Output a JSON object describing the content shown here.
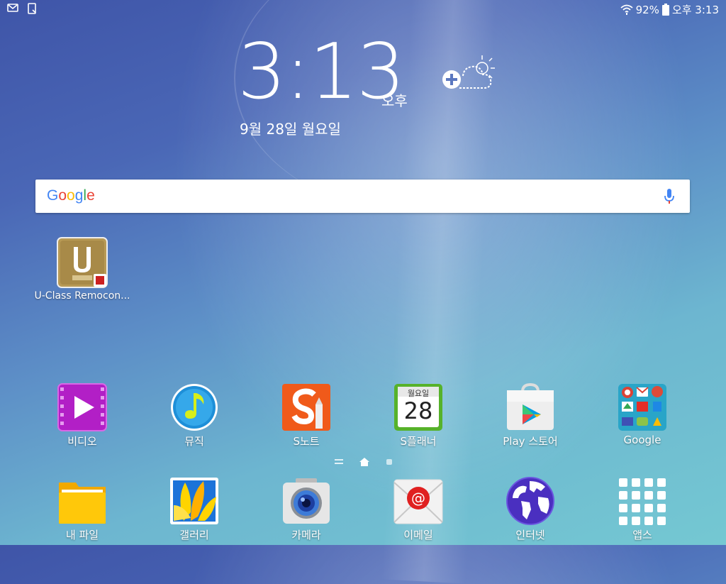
{
  "status_bar": {
    "battery_percent": "92%",
    "time": "오후 3:13",
    "icons": [
      "email-notification-icon",
      "screenshot-notification-icon",
      "wifi-icon",
      "battery-icon"
    ]
  },
  "clock": {
    "time": "3:13",
    "ampm": "오후",
    "date": "9월 28일 월요일"
  },
  "weather_widget": {
    "icon": "add-weather-icon"
  },
  "search_bar": {
    "logo": "Google",
    "icon": "mic-icon"
  },
  "desktop_shortcut": {
    "label": "U-Class Remocon...",
    "icon": "uclass-remocon-icon"
  },
  "apps_row": [
    {
      "label": "비디오",
      "icon": "video-icon"
    },
    {
      "label": "뮤직",
      "icon": "music-icon"
    },
    {
      "label": "S노트",
      "icon": "snote-icon"
    },
    {
      "label": "S플래너",
      "icon": "splanner-icon",
      "calendar_day": "28",
      "calendar_weekday": "월요일"
    },
    {
      "label": "Play 스토어",
      "icon": "play-store-icon"
    },
    {
      "label": "Google",
      "icon": "google-folder-icon"
    }
  ],
  "dock": [
    {
      "label": "내 파일",
      "icon": "my-files-icon"
    },
    {
      "label": "갤러리",
      "icon": "gallery-icon"
    },
    {
      "label": "카메라",
      "icon": "camera-icon"
    },
    {
      "label": "이메일",
      "icon": "email-icon"
    },
    {
      "label": "인터넷",
      "icon": "internet-icon"
    },
    {
      "label": "앱스",
      "icon": "apps-icon"
    }
  ],
  "page_indicator": {
    "pages": 3,
    "current": 1
  }
}
